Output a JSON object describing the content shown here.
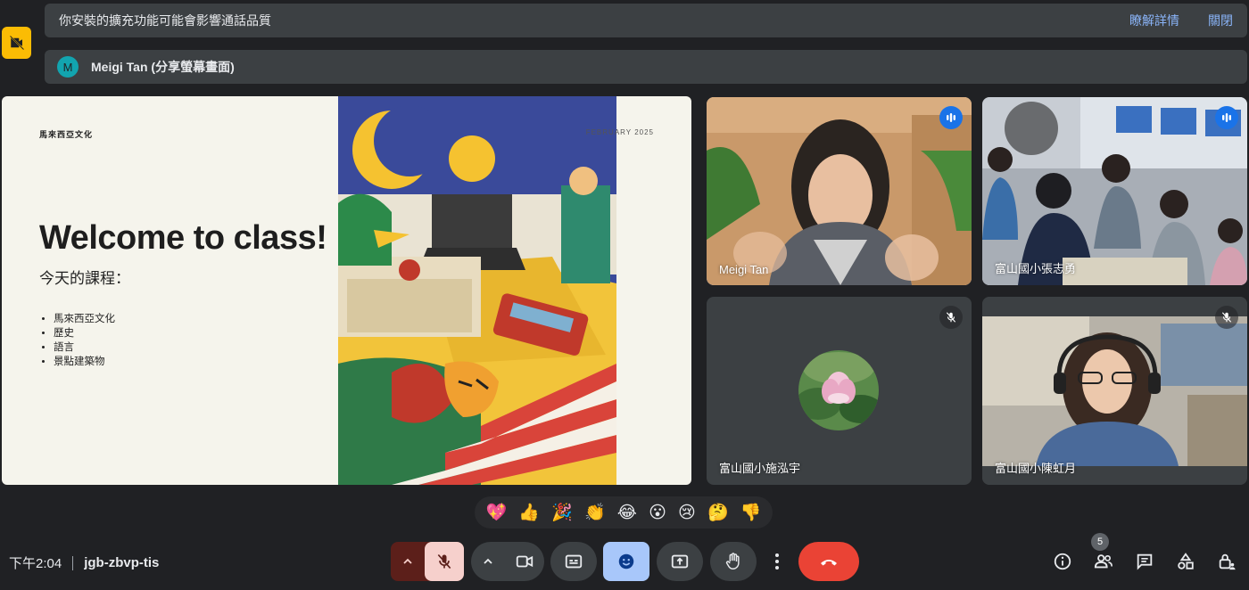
{
  "banner": {
    "message": "你安裝的擴充功能可能會影響通話品質",
    "learn_more": "瞭解詳情",
    "close": "關閉"
  },
  "presenter": {
    "avatar_letter": "M",
    "label": "Meigi Tan (分享螢幕畫面)"
  },
  "slide": {
    "topic": "馬來西亞文化",
    "date": "FEBRUARY 2025",
    "title": "Welcome to class!",
    "subtitle": "今天的課程：",
    "items": [
      "馬來西亞文化",
      "歷史",
      "語言",
      "景點建築物"
    ]
  },
  "tiles": [
    {
      "name": "Meigi Tan",
      "state": "speaking"
    },
    {
      "name": "富山國小張志勇",
      "state": "speaking"
    },
    {
      "name": "富山國小施泓宇",
      "state": "muted"
    },
    {
      "name": "富山國小陳虹月",
      "state": "muted"
    }
  ],
  "reactions": [
    "💖",
    "👍",
    "🎉",
    "👏",
    "😂",
    "😮",
    "😢",
    "🤔",
    "👎"
  ],
  "footer": {
    "time": "下午2:04",
    "meeting_code": "jgb-zbvp-tis",
    "participant_count": "5"
  },
  "colors": {
    "background": "#202124",
    "accent": "#8ab4f8",
    "leave": "#ea4335",
    "speaking": "#1a73e8",
    "warning": "#fbbc04"
  }
}
